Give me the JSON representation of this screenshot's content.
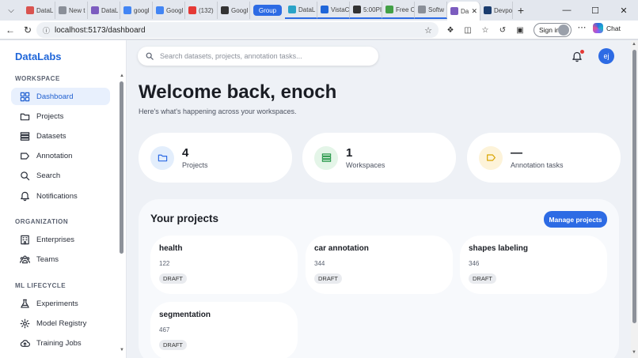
{
  "browser": {
    "tabs": [
      {
        "label": "DataL",
        "color": "#d9534f"
      },
      {
        "label": "New t",
        "color": "#8a8f98"
      },
      {
        "label": "DataL",
        "color": "#7c5cbf"
      },
      {
        "label": "googl",
        "color": "#4285f4"
      },
      {
        "label": "Googl",
        "color": "#4285f4"
      },
      {
        "label": "(132) ",
        "color": "#e53935"
      },
      {
        "label": "Googl",
        "color": "#333333"
      }
    ],
    "group_label": "Group",
    "group_tabs": [
      {
        "label": "DataL",
        "color": "#2aa3c7"
      },
      {
        "label": "VistaC",
        "color": "#1f66d9"
      },
      {
        "label": "5:00PI",
        "color": "#333333"
      },
      {
        "label": "Free C",
        "color": "#43a047"
      },
      {
        "label": "Softw",
        "color": "#8a8f98"
      }
    ],
    "active_tab": {
      "label": "Da",
      "color": "#7c5cbf"
    },
    "after_tabs": [
      {
        "label": "Devpo",
        "color": "#1a3c6e"
      }
    ],
    "url": "localhost:5173/dashboard",
    "signin_label": "Sign in",
    "copilot_label": "Chat"
  },
  "sidebar": {
    "brand": "DataLabs",
    "sections": [
      {
        "title": "WORKSPACE",
        "items": [
          {
            "label": "Dashboard",
            "icon": "dashboard-icon",
            "active": true
          },
          {
            "label": "Projects",
            "icon": "folder-icon"
          },
          {
            "label": "Datasets",
            "icon": "datasets-icon"
          },
          {
            "label": "Annotation",
            "icon": "tag-icon"
          },
          {
            "label": "Search",
            "icon": "search-icon"
          },
          {
            "label": "Notifications",
            "icon": "bell-icon"
          }
        ]
      },
      {
        "title": "ORGANIZATION",
        "items": [
          {
            "label": "Enterprises",
            "icon": "building-icon"
          },
          {
            "label": "Teams",
            "icon": "team-icon"
          }
        ]
      },
      {
        "title": "ML LIFECYCLE",
        "items": [
          {
            "label": "Experiments",
            "icon": "flask-icon"
          },
          {
            "label": "Model Registry",
            "icon": "gear-icon"
          },
          {
            "label": "Training Jobs",
            "icon": "cloud-upload-icon"
          }
        ]
      }
    ]
  },
  "header": {
    "search_placeholder": "Search datasets, projects, annotation tasks...",
    "avatar_initials": "ej"
  },
  "welcome": {
    "title": "Welcome back, enoch",
    "subtitle": "Here's what's happening across your workspaces."
  },
  "stats": [
    {
      "value": "4",
      "label": "Projects",
      "icon": "folder-icon",
      "bg": "#e3eefc",
      "fg": "#2d6be4"
    },
    {
      "value": "1",
      "label": "Workspaces",
      "icon": "datasets-icon",
      "bg": "#e4f5e8",
      "fg": "#2e9b4f"
    },
    {
      "value": "—",
      "label": "Annotation tasks",
      "icon": "tag-icon",
      "bg": "#fdf3d9",
      "fg": "#d9a400"
    }
  ],
  "projects": {
    "title": "Your projects",
    "manage_label": "Manage projects",
    "items": [
      {
        "name": "health",
        "count": "122",
        "status": "DRAFT"
      },
      {
        "name": "car annotation",
        "count": "344",
        "status": "DRAFT"
      },
      {
        "name": "shapes labeling",
        "count": "346",
        "status": "DRAFT"
      },
      {
        "name": "segmentation",
        "count": "467",
        "status": "DRAFT"
      }
    ]
  }
}
